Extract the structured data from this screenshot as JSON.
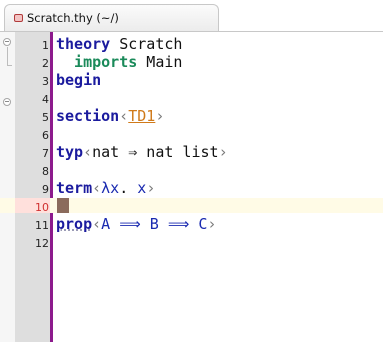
{
  "tab": {
    "title": "Scratch.thy (~/)"
  },
  "editor": {
    "current_line": 10,
    "lines": [
      {
        "num": "1",
        "k1": "theory",
        "t1": " Scratch"
      },
      {
        "num": "2",
        "k1": "  imports",
        "t1": " Main"
      },
      {
        "num": "3",
        "k1": "begin"
      },
      {
        "num": "4"
      },
      {
        "num": "5",
        "k1": "section",
        "c1": "‹",
        "link": "TD1",
        "c2": "›"
      },
      {
        "num": "6"
      },
      {
        "num": "7",
        "k1": "typ",
        "c1": "‹",
        "t1": "nat ",
        "s1": "⇒",
        "t2": " nat list",
        "c2": "›"
      },
      {
        "num": "8"
      },
      {
        "num": "9",
        "k1": "term",
        "c1": "‹",
        "s1": "λx",
        "t1": ". ",
        "s2": "x",
        "c2": "›"
      },
      {
        "num": "10"
      },
      {
        "num": "11",
        "k1": "prop",
        "c1": "‹",
        "s1": "A",
        "t1": " ",
        "s2": "⟹",
        "t2": " ",
        "s3": "B",
        "t3": " ",
        "s4": "⟹",
        "t4": " ",
        "s5": "C",
        "c2": "›"
      },
      {
        "num": "12"
      }
    ]
  },
  "colors": {
    "keyword": "#1b1b9e",
    "imports_keyword": "#1a8a5a",
    "cartouche": "#7a7a7a",
    "section_link": "#d07a1a",
    "free_variable": "#1a2ab0",
    "gutter_bar": "#8c1a8c",
    "current_line_number": "#d03030",
    "cursor": "#8b6b5c"
  },
  "icons": {
    "tab_icon": "theory-file-icon",
    "fold_open": "fold-collapse-icon"
  }
}
